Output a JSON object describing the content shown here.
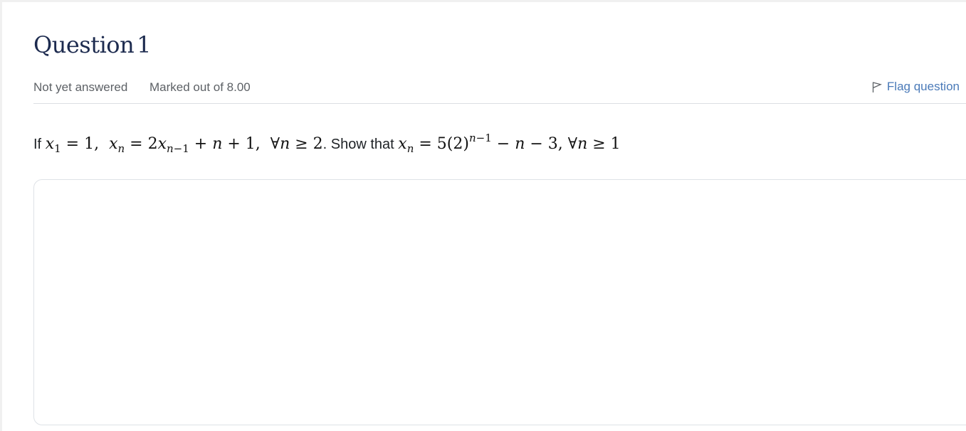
{
  "question": {
    "label": "Question",
    "number": "1",
    "state": "Not yet answered",
    "grade": "Marked out of 8.00",
    "flag_label": "Flag question",
    "text": {
      "prefix": "If",
      "mid": ". Show that"
    },
    "answer_value": ""
  },
  "colors": {
    "title": "#1d2b4f",
    "link": "#4a7ab8",
    "meta_text": "#5d6166"
  },
  "icons": {
    "flag": "flag-outline-icon"
  }
}
